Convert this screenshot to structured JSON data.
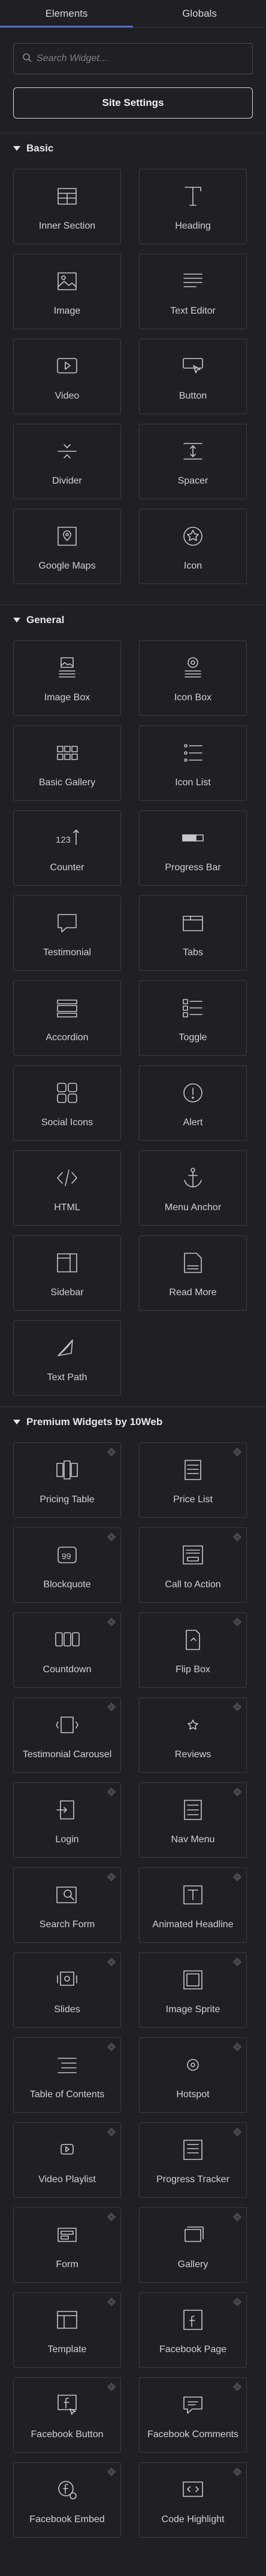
{
  "tabs": [
    {
      "label": "Elements"
    },
    {
      "label": "Globals"
    }
  ],
  "search": {
    "placeholder": "Search Widget..."
  },
  "site_settings_label": "Site Settings",
  "categories": [
    {
      "title": "Basic",
      "widgets": [
        {
          "label": "Inner Section",
          "icon": "inner-section-icon"
        },
        {
          "label": "Heading",
          "icon": "heading-icon"
        },
        {
          "label": "Image",
          "icon": "image-icon"
        },
        {
          "label": "Text Editor",
          "icon": "text-editor-icon"
        },
        {
          "label": "Video",
          "icon": "video-icon"
        },
        {
          "label": "Button",
          "icon": "button-icon"
        },
        {
          "label": "Divider",
          "icon": "divider-icon"
        },
        {
          "label": "Spacer",
          "icon": "spacer-icon"
        },
        {
          "label": "Google Maps",
          "icon": "google-maps-icon"
        },
        {
          "label": "Icon",
          "icon": "star-icon"
        }
      ]
    },
    {
      "title": "General",
      "widgets": [
        {
          "label": "Image Box",
          "icon": "image-box-icon"
        },
        {
          "label": "Icon Box",
          "icon": "icon-box-icon"
        },
        {
          "label": "Basic Gallery",
          "icon": "basic-gallery-icon"
        },
        {
          "label": "Icon List",
          "icon": "icon-list-icon"
        },
        {
          "label": "Counter",
          "icon": "counter-icon"
        },
        {
          "label": "Progress Bar",
          "icon": "progress-bar-icon"
        },
        {
          "label": "Testimonial",
          "icon": "testimonial-icon"
        },
        {
          "label": "Tabs",
          "icon": "tabs-icon"
        },
        {
          "label": "Accordion",
          "icon": "accordion-icon"
        },
        {
          "label": "Toggle",
          "icon": "toggle-icon"
        },
        {
          "label": "Social Icons",
          "icon": "social-icons-icon"
        },
        {
          "label": "Alert",
          "icon": "alert-icon"
        },
        {
          "label": "HTML",
          "icon": "html-icon"
        },
        {
          "label": "Menu Anchor",
          "icon": "anchor-icon"
        },
        {
          "label": "Sidebar",
          "icon": "sidebar-icon"
        },
        {
          "label": "Read More",
          "icon": "read-more-icon"
        },
        {
          "label": "Text Path",
          "icon": "text-path-icon"
        }
      ]
    },
    {
      "title": "Premium Widgets by 10Web",
      "widgets": [
        {
          "label": "Pricing Table",
          "icon": "pricing-table-icon",
          "pro": true
        },
        {
          "label": "Price List",
          "icon": "price-list-icon",
          "pro": true
        },
        {
          "label": "Blockquote",
          "icon": "blockquote-icon",
          "pro": true
        },
        {
          "label": "Call to Action",
          "icon": "call-to-action-icon",
          "pro": true
        },
        {
          "label": "Countdown",
          "icon": "countdown-icon",
          "pro": true
        },
        {
          "label": "Flip Box",
          "icon": "flip-box-icon",
          "pro": true
        },
        {
          "label": "Testimonial Carousel",
          "icon": "testimonial-carousel-icon",
          "pro": true
        },
        {
          "label": "Reviews",
          "icon": "reviews-icon",
          "pro": true
        },
        {
          "label": "Login",
          "icon": "login-icon",
          "pro": true
        },
        {
          "label": "Nav Menu",
          "icon": "nav-menu-icon",
          "pro": true
        },
        {
          "label": "Search Form",
          "icon": "search-form-icon",
          "pro": true
        },
        {
          "label": "Animated Headline",
          "icon": "animated-headline-icon",
          "pro": true
        },
        {
          "label": "Slides",
          "icon": "slides-icon",
          "pro": true
        },
        {
          "label": "Image Sprite",
          "icon": "image-sprite-icon",
          "pro": true
        },
        {
          "label": "Table of Contents",
          "icon": "table-of-contents-icon",
          "pro": true
        },
        {
          "label": "Hotspot",
          "icon": "hotspot-icon",
          "pro": true
        },
        {
          "label": "Video Playlist",
          "icon": "video-playlist-icon",
          "pro": true
        },
        {
          "label": "Progress Tracker",
          "icon": "progress-tracker-icon",
          "pro": true
        },
        {
          "label": "Form",
          "icon": "form-icon",
          "pro": true
        },
        {
          "label": "Gallery",
          "icon": "gallery-icon",
          "pro": true
        },
        {
          "label": "Template",
          "icon": "template-icon",
          "pro": true
        },
        {
          "label": "Facebook Page",
          "icon": "facebook-page-icon",
          "pro": true
        },
        {
          "label": "Facebook Button",
          "icon": "facebook-button-icon",
          "pro": true
        },
        {
          "label": "Facebook Comments",
          "icon": "facebook-comments-icon",
          "pro": true
        },
        {
          "label": "Facebook Embed",
          "icon": "facebook-embed-icon",
          "pro": true
        },
        {
          "label": "Code Highlight",
          "icon": "code-highlight-icon",
          "pro": true
        }
      ]
    }
  ],
  "colors": {
    "background": "#1f2024",
    "tab_accent": "#5b6ad6",
    "card_border": "#3b3d43"
  }
}
